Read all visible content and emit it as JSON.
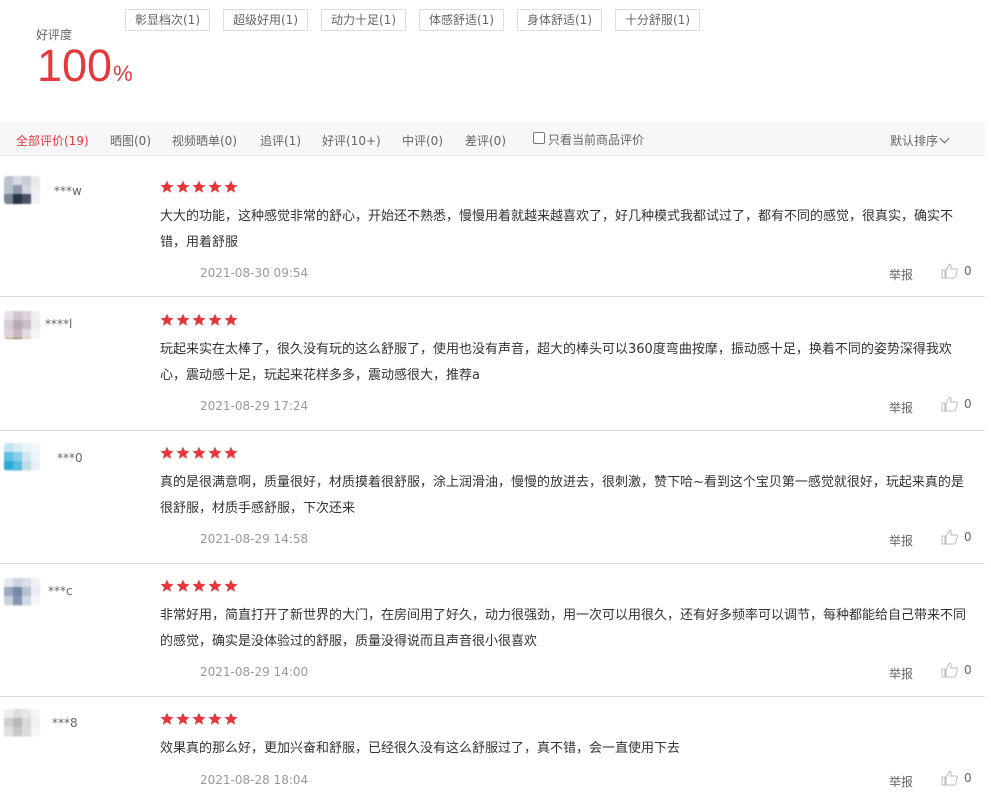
{
  "summary": {
    "rate_label": "好评度",
    "rate_value": "100",
    "rate_unit": "%",
    "tags": [
      "彰显档次(1)",
      "超级好用(1)",
      "动力十足(1)",
      "体感舒适(1)",
      "身体舒适(1)",
      "十分舒服(1)"
    ]
  },
  "filters": {
    "tabs": [
      {
        "label": "全部评价(19)",
        "active": true
      },
      {
        "label": "晒图(0)"
      },
      {
        "label": "视频晒单(0)"
      },
      {
        "label": "追评(1)"
      },
      {
        "label": "好评(10+)"
      },
      {
        "label": "中评(0)"
      },
      {
        "label": "差评(0)"
      }
    ],
    "checkbox_label": "只看当前商品评价",
    "sort_label": "默认排序"
  },
  "reviews": [
    {
      "user": "***w",
      "stars": 5,
      "content": "大大的功能，这种感觉非常的舒心，开始还不熟悉，慢慢用着就越来越喜欢了，好几种模式我都试过了，都有不同的感觉，很真实，确实不错，用着舒服",
      "date": "2021-08-30 09:54",
      "report": "举报",
      "likes": "0"
    },
    {
      "user": "****l",
      "stars": 5,
      "content": "玩起来实在太棒了，很久没有玩的这么舒服了，使用也没有声音，超大的棒头可以360度弯曲按摩，振动感十足，换着不同的姿势深得我欢心，震动感十足，玩起来花样多多，震动感很大，推荐a",
      "date": "2021-08-29 17:24",
      "report": "举报",
      "likes": "0"
    },
    {
      "user": "***0",
      "stars": 5,
      "content": "真的是很满意啊，质量很好，材质摸着很舒服，涂上润滑油，慢慢的放进去，很刺激，赞下哈~看到这个宝贝第一感觉就很好，玩起来真的是很舒服，材质手感舒服，下次还来",
      "date": "2021-08-29 14:58",
      "report": "举报",
      "likes": "0"
    },
    {
      "user": "***c",
      "stars": 5,
      "content": "非常好用，简直打开了新世界的大门，在房间用了好久，动力很强劲，用一次可以用很久，还有好多频率可以调节，每种都能给自己带来不同的感觉，确实是没体验过的舒服，质量没得说而且声音很小很喜欢",
      "date": "2021-08-29 14:00",
      "report": "举报",
      "likes": "0"
    },
    {
      "user": "***8",
      "stars": 5,
      "content": "效果真的那么好，更加兴奋和舒服，已经很久没有这么舒服过了，真不错，会一直使用下去",
      "date": "2021-08-28 18:04",
      "report": "举报",
      "likes": "0"
    }
  ],
  "colors": {
    "accent": "#e4393c",
    "star": "#e4393c"
  }
}
